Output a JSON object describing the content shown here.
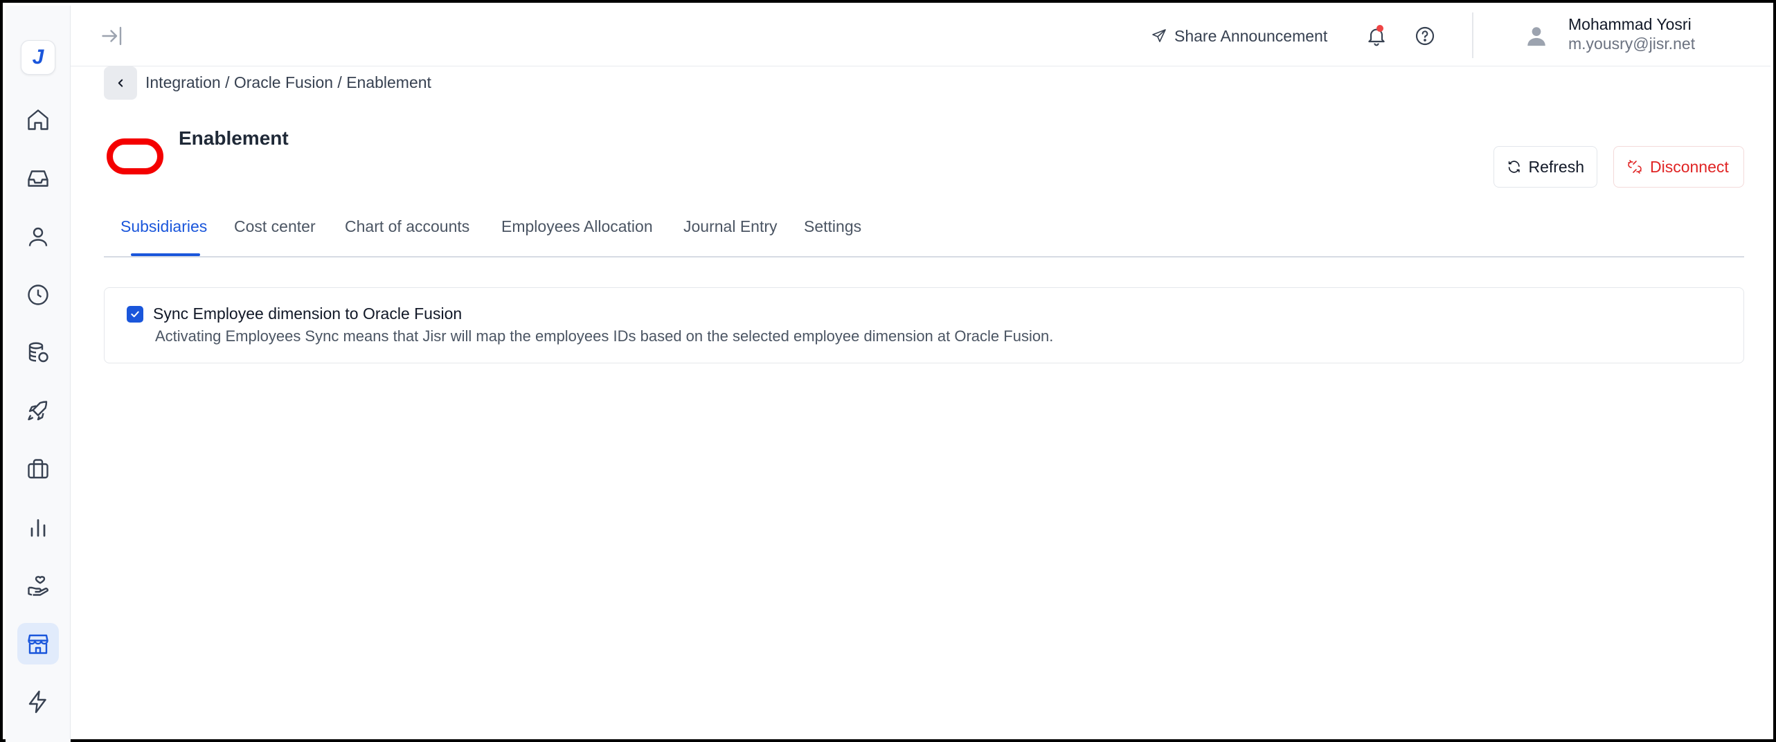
{
  "app": {
    "logo_letter": "J",
    "accent_color": "#1a56db",
    "danger_color": "#e02424"
  },
  "sidebar": {
    "items": [
      {
        "name": "home-icon"
      },
      {
        "name": "inbox-icon"
      },
      {
        "name": "user-icon"
      },
      {
        "name": "clock-icon"
      },
      {
        "name": "coins-icon"
      },
      {
        "name": "rocket-icon"
      },
      {
        "name": "briefcase-icon"
      },
      {
        "name": "bar-chart-icon"
      },
      {
        "name": "hand-heart-icon"
      },
      {
        "name": "store-icon",
        "active": true
      },
      {
        "name": "lightning-icon"
      }
    ]
  },
  "header": {
    "share_label": "Share Announcement",
    "user_name": "Mohammad Yosri",
    "user_email": "m.yousry@jisr.net"
  },
  "breadcrumb": {
    "text": "Integration / Oracle Fusion / Enablement"
  },
  "page": {
    "title": "Enablement",
    "refresh_label": "Refresh",
    "disconnect_label": "Disconnect"
  },
  "tabs": [
    {
      "label": "Subsidiaries",
      "active": true
    },
    {
      "label": "Cost center"
    },
    {
      "label": "Chart of accounts"
    },
    {
      "label": "Employees Allocation"
    },
    {
      "label": "Journal Entry"
    },
    {
      "label": "Settings"
    }
  ],
  "sync_option": {
    "checked": true,
    "title": "Sync Employee dimension to Oracle Fusion",
    "description": "Activating Employees Sync means that Jisr will map the employees IDs based on the selected employee dimension at Oracle Fusion."
  }
}
